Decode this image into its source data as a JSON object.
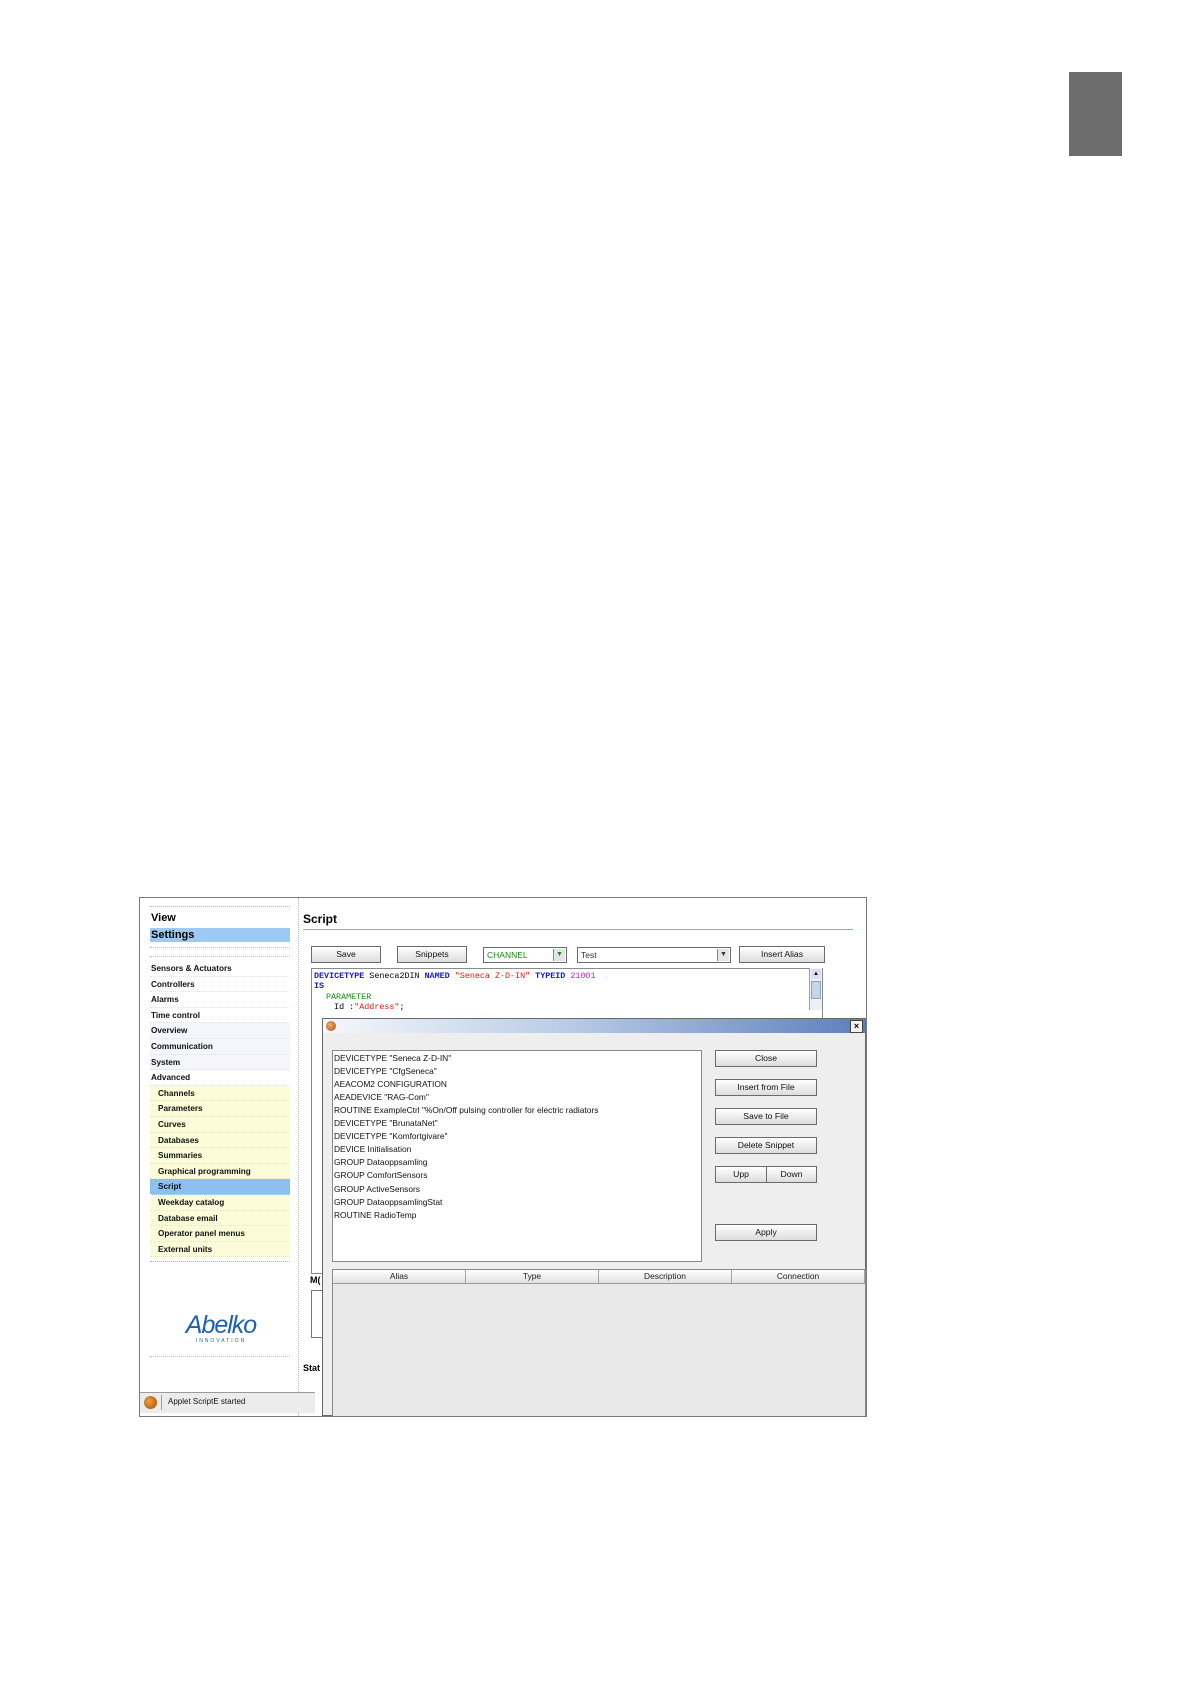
{
  "app": {
    "nav": {
      "view": "View",
      "settings": "Settings",
      "items": [
        {
          "label": "Sensors & Actuators",
          "sub": false,
          "selected": false
        },
        {
          "label": "Controllers",
          "sub": false,
          "selected": false
        },
        {
          "label": "Alarms",
          "sub": false,
          "selected": false
        },
        {
          "label": "Time control",
          "sub": false,
          "selected": false
        },
        {
          "label": "Overview",
          "sub": false,
          "selected": false
        },
        {
          "label": "Communication",
          "sub": false,
          "selected": false
        },
        {
          "label": "System",
          "sub": false,
          "selected": false
        },
        {
          "label": "Advanced",
          "sub": false,
          "selected": false
        },
        {
          "label": "Channels",
          "sub": true,
          "selected": false
        },
        {
          "label": "Parameters",
          "sub": true,
          "selected": false
        },
        {
          "label": "Curves",
          "sub": true,
          "selected": false
        },
        {
          "label": "Databases",
          "sub": true,
          "selected": false
        },
        {
          "label": "Summaries",
          "sub": true,
          "selected": false
        },
        {
          "label": "Graphical programming",
          "sub": true,
          "selected": false
        },
        {
          "label": "Script",
          "sub": true,
          "selected": true
        },
        {
          "label": "Weekday catalog",
          "sub": true,
          "selected": false
        },
        {
          "label": "Database email",
          "sub": true,
          "selected": false
        },
        {
          "label": "Operator panel menus",
          "sub": true,
          "selected": false
        },
        {
          "label": "External units",
          "sub": true,
          "selected": false
        }
      ],
      "logo_main": "Abelko",
      "logo_sub": "INNOVATION"
    },
    "status_bar": {
      "text": "Applet ScriptE started"
    },
    "main": {
      "title": "Script",
      "toolbar": {
        "save": "Save",
        "snippets": "Snippets",
        "channel_combo": "CHANNEL",
        "test_combo": "Test",
        "insert_alias": "Insert Alias"
      },
      "code": {
        "kw_devicetype": "DEVICETYPE",
        "name": " Seneca2DIN ",
        "kw_named": "NAMED",
        "named_str": " \"Seneca Z-D-IN\" ",
        "kw_typeid": "TYPEID",
        "typeid": " 21001",
        "kw_is": "IS",
        "kw_parameter": "PARAMETER",
        "param_prefix": "    Id :",
        "param_str": "\"Address\"",
        "param_suffix": ";"
      },
      "m_label": "M(",
      "stat_label": "Stat"
    },
    "dialog": {
      "snippets": [
        "DEVICETYPE \"Seneca Z-D-IN\"",
        "DEVICETYPE \"CfgSeneca\"",
        "AEACOM2 CONFIGURATION",
        "AEADEVICE \"RAG-Com\"",
        "ROUTINE ExampleCtrl \"%On/Off pulsing controller for electric radiators",
        "DEVICETYPE \"BrunataNet\"",
        "DEVICETYPE \"Komfortgivare\"",
        "DEVICE Initialisation",
        "GROUP Dataoppsamling",
        "GROUP ComfortSensors",
        "GROUP ActiveSensors",
        "GROUP DataoppsamlingStat",
        "ROUTINE RadioTemp"
      ],
      "buttons": {
        "close": "Close",
        "insert_from_file": "Insert from File",
        "save_to_file": "Save to File",
        "delete_snippet": "Delete Snippet",
        "upp": "Upp",
        "down": "Down",
        "apply": "Apply"
      },
      "table_columns": [
        "Alias",
        "Type",
        "Description",
        "Connection"
      ],
      "close_glyph": "×"
    }
  }
}
